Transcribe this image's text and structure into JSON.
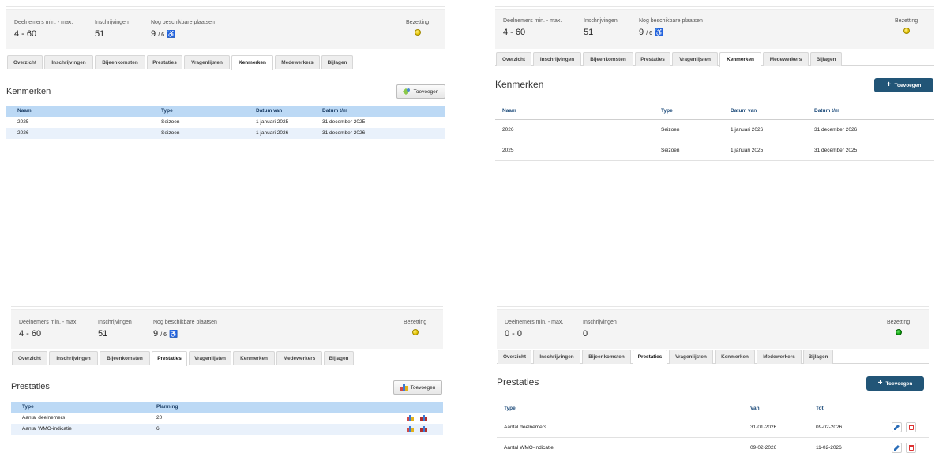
{
  "stats_labels": {
    "deelnemers": "Deelnemers min. - max.",
    "inschrijvingen": "Inschrijvingen",
    "beschikbaar": "Nog beschikbare plaatsen",
    "bezetting": "Bezetting"
  },
  "tab_labels": [
    "Overzicht",
    "Inschrijvingen",
    "Bijeenkomsten",
    "Prestaties",
    "Vragenlijsten",
    "Kenmerken",
    "Medewerkers",
    "Bijlagen"
  ],
  "add_label": "Toevoegen",
  "colors": {
    "accent_button": "#225577",
    "old_header": "#bcd9f5",
    "status_yellow": "#e5c400",
    "status_green": "#0aa10a"
  },
  "panels": {
    "kenmerken_old": {
      "stats": {
        "deelnemers": "4 - 60",
        "inschrijvingen": "51",
        "beschikbaar_main": "9",
        "beschikbaar_small": "/ 6",
        "bezetting_status": "yellow"
      },
      "active_tab": "Kenmerken",
      "section_title": "Kenmerken",
      "columns": [
        "Naam",
        "Type",
        "Datum van",
        "Datum t/m"
      ],
      "rows": [
        [
          "2025",
          "Seizoen",
          "1 januari 2025",
          "31 december 2025"
        ],
        [
          "2026",
          "Seizoen",
          "1 januari 2026",
          "31 december 2026"
        ]
      ]
    },
    "kenmerken_new": {
      "stats": {
        "deelnemers": "4 - 60",
        "inschrijvingen": "51",
        "beschikbaar_main": "9",
        "beschikbaar_small": "/ 6",
        "bezetting_status": "yellow"
      },
      "active_tab": "Kenmerken",
      "section_title": "Kenmerken",
      "columns": [
        "Naam",
        "Type",
        "Datum van",
        "Datum t/m"
      ],
      "rows": [
        [
          "2026",
          "Seizoen",
          "1 januari 2026",
          "31 december 2026"
        ],
        [
          "2025",
          "Seizoen",
          "1 januari 2025",
          "31 december 2025"
        ]
      ]
    },
    "prestaties_old": {
      "stats": {
        "deelnemers": "4 - 60",
        "inschrijvingen": "51",
        "beschikbaar_main": "9",
        "beschikbaar_small": "/ 6",
        "bezetting_status": "yellow"
      },
      "active_tab": "Prestaties",
      "section_title": "Prestaties",
      "columns": [
        "Type",
        "Planning"
      ],
      "rows": [
        [
          "Aantal deelnemers",
          "20"
        ],
        [
          "Aantal WMO-indicatie",
          "6"
        ]
      ]
    },
    "prestaties_new": {
      "stats": {
        "deelnemers": "0 - 0",
        "inschrijvingen": "0",
        "bezetting_status": "green"
      },
      "active_tab": "Prestaties",
      "section_title": "Prestaties",
      "columns": [
        "Type",
        "Van",
        "Tot"
      ],
      "rows": [
        [
          "Aantal deelnemers",
          "31-01-2026",
          "09-02-2026"
        ],
        [
          "Aantal WMO-indicatie",
          "09-02-2026",
          "11-02-2026"
        ]
      ]
    }
  }
}
